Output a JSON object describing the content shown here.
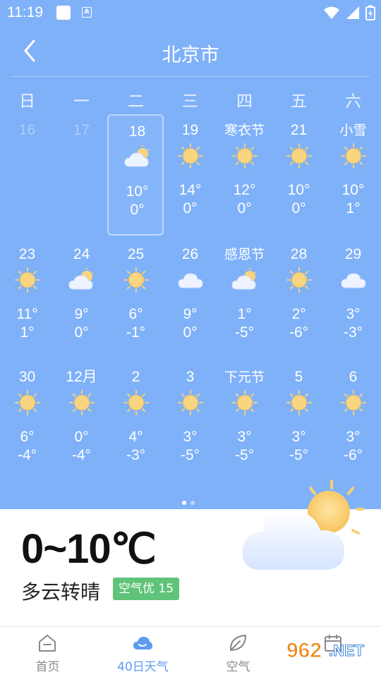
{
  "status": {
    "time": "11:19",
    "a_label": "A"
  },
  "header": {
    "title": "北京市"
  },
  "weekdays": [
    "日",
    "一",
    "二",
    "三",
    "四",
    "五",
    "六"
  ],
  "days": [
    {
      "label": "16",
      "hi": "",
      "lo": "",
      "icon": "",
      "dim": true
    },
    {
      "label": "17",
      "hi": "",
      "lo": "",
      "icon": "",
      "dim": true
    },
    {
      "label": "18",
      "hi": "10°",
      "lo": "0°",
      "icon": "partly-cloudy-icon",
      "selected": true
    },
    {
      "label": "19",
      "hi": "14°",
      "lo": "0°",
      "icon": "sun-icon"
    },
    {
      "label": "寒衣节",
      "hi": "12°",
      "lo": "0°",
      "icon": "sun-icon",
      "festival": true
    },
    {
      "label": "21",
      "hi": "10°",
      "lo": "0°",
      "icon": "sun-icon"
    },
    {
      "label": "小雪",
      "hi": "10°",
      "lo": "1°",
      "icon": "sun-icon",
      "festival": true
    },
    {
      "label": "23",
      "hi": "11°",
      "lo": "1°",
      "icon": "sun-icon"
    },
    {
      "label": "24",
      "hi": "9°",
      "lo": "0°",
      "icon": "partly-cloudy-icon"
    },
    {
      "label": "25",
      "hi": "6°",
      "lo": "-1°",
      "icon": "sun-icon"
    },
    {
      "label": "26",
      "hi": "9°",
      "lo": "0°",
      "icon": "cloud-icon"
    },
    {
      "label": "感恩节",
      "hi": "1°",
      "lo": "-5°",
      "icon": "partly-cloudy-icon",
      "festival": true
    },
    {
      "label": "28",
      "hi": "2°",
      "lo": "-6°",
      "icon": "sun-icon"
    },
    {
      "label": "29",
      "hi": "3°",
      "lo": "-3°",
      "icon": "cloud-icon"
    },
    {
      "label": "30",
      "hi": "6°",
      "lo": "-4°",
      "icon": "sun-icon"
    },
    {
      "label": "12月",
      "hi": "0°",
      "lo": "-4°",
      "icon": "sun-icon"
    },
    {
      "label": "2",
      "hi": "4°",
      "lo": "-3°",
      "icon": "sun-icon"
    },
    {
      "label": "3",
      "hi": "3°",
      "lo": "-5°",
      "icon": "sun-icon"
    },
    {
      "label": "下元节",
      "hi": "3°",
      "lo": "-5°",
      "icon": "sun-icon",
      "festival": true
    },
    {
      "label": "5",
      "hi": "3°",
      "lo": "-5°",
      "icon": "sun-icon"
    },
    {
      "label": "6",
      "hi": "3°",
      "lo": "-6°",
      "icon": "sun-icon"
    }
  ],
  "pager": {
    "pages": 2,
    "active": 0
  },
  "summary": {
    "temp_range": "0~10℃",
    "condition": "多云转晴",
    "aqi": "空气优 15"
  },
  "tabs": [
    {
      "label": "首页",
      "icon": "home-icon",
      "active": false
    },
    {
      "label": "40日天气",
      "icon": "cloud-icon",
      "active": true
    },
    {
      "label": "空气",
      "icon": "leaf-icon",
      "active": false
    },
    {
      "label": "",
      "icon": "calendar-icon",
      "active": false
    }
  ],
  "watermark": {
    "text1": "962",
    "text2": ".NET",
    "text3": "乐游网"
  },
  "colors": {
    "background": "#7fb1f9",
    "accent": "#5d9cf0",
    "aqi": "#5fc37a"
  }
}
